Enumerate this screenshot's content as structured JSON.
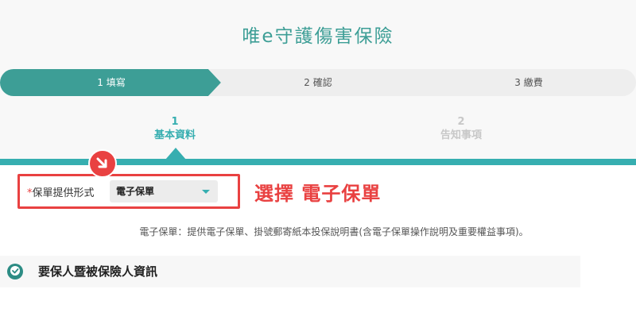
{
  "header": {
    "title": "唯e守護傷害保險"
  },
  "progress": {
    "steps": [
      {
        "label": "1 填寫",
        "state": "active"
      },
      {
        "label": "2 確認",
        "state": "pending"
      },
      {
        "label": "3 繳費",
        "state": "pending"
      }
    ]
  },
  "substeps": [
    {
      "number": "1",
      "label": "基本資料",
      "state": "active"
    },
    {
      "number": "2",
      "label": "告知事項",
      "state": "pending"
    }
  ],
  "form": {
    "required_mark": "*",
    "field_label": "保單提供形式",
    "select_value": "電子保單"
  },
  "annotation": {
    "text": "選擇 電子保單"
  },
  "note": {
    "text": "電子保單：提供電子保單、掛號郵寄紙本投保說明書(含電子保單操作說明及重要權益事項)。"
  },
  "section": {
    "title": "要保人暨被保險人資訊"
  },
  "colors": {
    "accent": "#36aeb0",
    "accent_dark": "#3d9e96",
    "highlight": "#e94141"
  },
  "icons": {
    "badge": "arrow-down-right-icon",
    "section": "person-check-icon",
    "select": "chevron-down-icon"
  }
}
